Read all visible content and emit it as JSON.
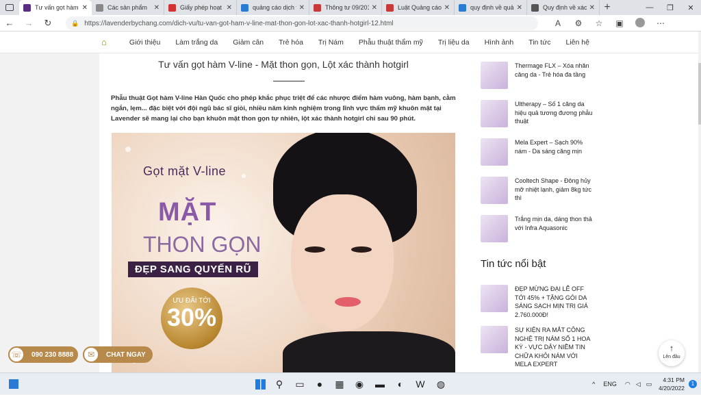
{
  "tabs": [
    {
      "title": "Tư vấn gọt hàm V",
      "color": "#5b2d82",
      "active": true
    },
    {
      "title": "Các sản phẩm",
      "color": "#888888"
    },
    {
      "title": "Giấy phép hoạt độ",
      "color": "#d23232"
    },
    {
      "title": "quảng cáo dịch v",
      "color": "#2a7bd4"
    },
    {
      "title": "Thông tư 09/2015",
      "color": "#c83a3a"
    },
    {
      "title": "Luật Quảng cáo 2",
      "color": "#c83a3a"
    },
    {
      "title": "quy định về quả",
      "color": "#2a7bd4"
    },
    {
      "title": "Quy định về xác r",
      "color": "#555555"
    }
  ],
  "address": {
    "url": "https://lavenderbychang.com/dich-vu/tu-van-got-ham-v-line-mat-thon-gon-lot-xac-thanh-hotgirl-12.html"
  },
  "nav": [
    "Giới thiệu",
    "Làm trắng da",
    "Giảm cân",
    "Trẻ hóa",
    "Trị Nám",
    "Phẫu thuật thẩm mỹ",
    "Trị liệu da",
    "Hình ảnh",
    "Tin tức",
    "Liên hệ"
  ],
  "article": {
    "title": "Tư vấn gọt hàm V-line - Mặt thon gọn, Lột xác thành hotgirl",
    "intro": "Phẫu thuật Gọt hàm V-line Hàn Quốc cho phép khắc phục triệt để các nhược điểm hàm vuông, hàm bạnh, cằm ngắn, lẹm... đặc biệt với đội ngũ bác sĩ giỏi, nhiều năm kinh nghiệm trong lĩnh vực thẩm mỹ khuôn mặt tại Lavender sẽ mang lại cho bạn khuôn mặt thon gọn tự nhiên, lột xác thành hotgirl chỉ sau 90 phút.",
    "banner": {
      "line1": "Gọt mặt V-line",
      "line2": "MẶT",
      "line3": "THON GỌN",
      "line4": "ĐẸP SANG QUYẾN RŨ",
      "badge_small": "ƯU ĐÃI TỚI",
      "badge_big": "30%"
    }
  },
  "sidebar": {
    "items": [
      "Thermage FLX – Xóa nhăn căng da - Trẻ hóa đa tầng",
      "Ultherapy – Số 1 căng da hiệu quả tương đương phẫu thuật",
      "Mela Expert – Sạch 90% nám - Da sáng căng mịn",
      "Cooltech Shape - Đông hủy mỡ nhiệt lạnh, giảm 8kg tức thì",
      "Trắng mịn da, dáng thon thả với Infra Aquasonic"
    ],
    "heading": "Tin tức nổi bật",
    "news": [
      "ĐẸP MỪNG ĐẠI LỄ OFF TỚI 45% + TẶNG GÓI DA SÁNG SẠCH MỊN TRỊ GIÁ 2.760.000Đ!",
      "SỰ KIỆN RA MẮT CÔNG NGHỆ TRỊ NÁM SỐ 1 HOA KỲ - VỰC DẬY NIỀM TIN CHỮA KHỎI NÁM VỚI MELA EXPERT"
    ]
  },
  "contact": {
    "phone": "090 230 8888",
    "chat": "CHAT NGAY"
  },
  "backtop": "Lên đầu",
  "tray": {
    "lang": "ENG",
    "time": "4:31 PM",
    "date": "4/20/2022",
    "notif": "1"
  }
}
